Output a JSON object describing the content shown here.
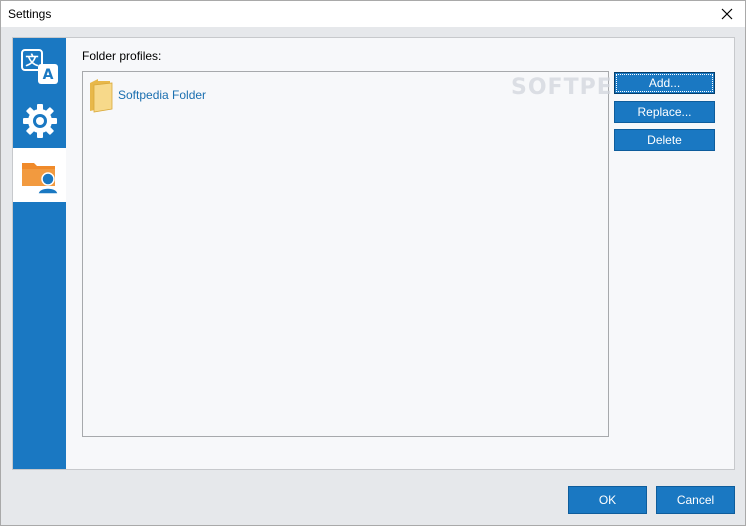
{
  "window": {
    "title": "Settings",
    "close_icon": "close-icon"
  },
  "sidebar": {
    "items": [
      {
        "name": "language",
        "icon": "translate-icon",
        "active": false
      },
      {
        "name": "general",
        "icon": "gear-icon",
        "active": false
      },
      {
        "name": "folder-profiles",
        "icon": "folder-user-icon",
        "active": true
      }
    ],
    "accent_color": "#1a78c2"
  },
  "panel": {
    "label": "Folder profiles:",
    "profiles": [
      {
        "label": "Softpedia Folder",
        "icon": "folder-icon"
      }
    ],
    "buttons": {
      "add": "Add...",
      "replace": "Replace...",
      "delete": "Delete"
    }
  },
  "watermark": "SOFTPEDIA",
  "footer": {
    "ok": "OK",
    "cancel": "Cancel"
  },
  "colors": {
    "button_blue": "#1a78c2",
    "link_blue": "#1a6fb0",
    "folder_yellow": "#f3cf6b",
    "profile_orange": "#f08a2a"
  }
}
